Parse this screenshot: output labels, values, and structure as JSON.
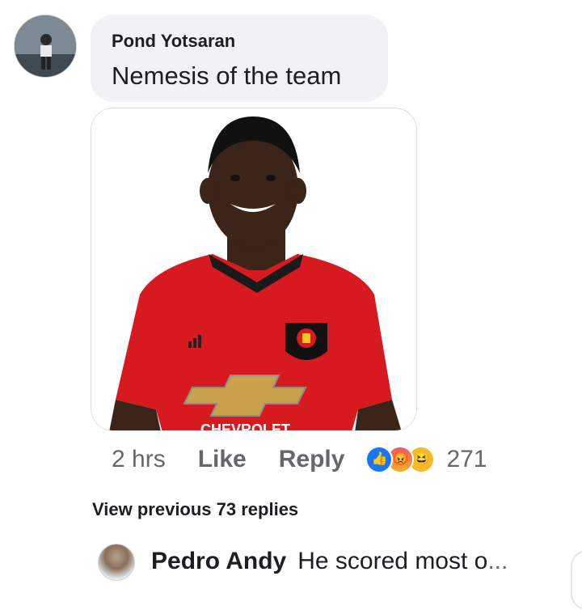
{
  "comment": {
    "author": "Pond Yotsaran",
    "text": "Nemesis of the team",
    "attachment": {
      "image": "player-photo",
      "jersey_sponsor": "CHEVROLET",
      "kit_brand": "adidas",
      "background": "#ffffff",
      "jersey_color": "#d71920"
    },
    "time": "2 hrs",
    "like_label": "Like",
    "reply_label": "Reply",
    "reactions": [
      "like-icon",
      "angry-icon",
      "haha-icon"
    ],
    "reaction_count": "271"
  },
  "replies": {
    "view_previous_label": "View previous 73 replies",
    "latest": {
      "author": "Pedro Andy",
      "text": "He scored most o",
      "ellipsis": "..."
    }
  },
  "colors": {
    "bubble": "#f0f2f5",
    "meta_text": "#65676b",
    "like_blue": "#1877f2"
  }
}
